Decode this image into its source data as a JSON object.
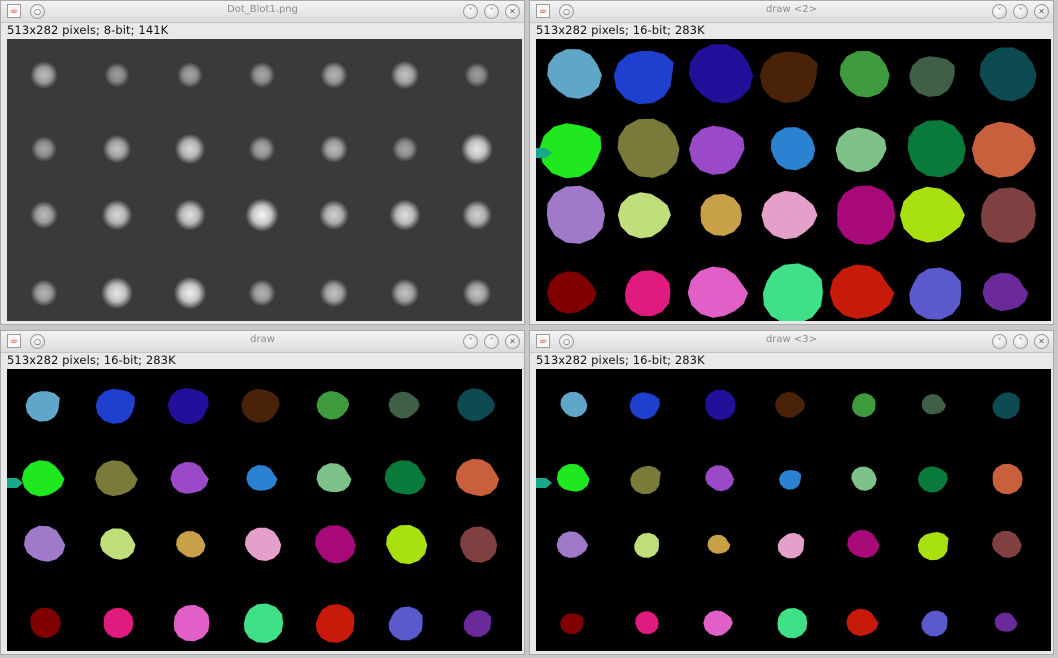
{
  "windows": [
    {
      "key": "w0",
      "title": "Dot_Blot1.png",
      "info": "513x282 pixels; 8-bit; 141K",
      "icon": "java-coffee-icon"
    },
    {
      "key": "w1",
      "title": "draw <2>",
      "info": "513x282 pixels; 16-bit; 283K",
      "icon": "java-coffee-icon"
    },
    {
      "key": "w2",
      "title": "draw",
      "info": "513x282 pixels; 16-bit; 283K",
      "icon": "java-coffee-icon"
    },
    {
      "key": "w3",
      "title": "draw <3>",
      "info": "513x282 pixels; 16-bit; 283K",
      "icon": "java-coffee-icon"
    }
  ],
  "window_buttons": {
    "menu_glyph": "○",
    "minimize_glyph": "˅",
    "maximize_glyph": "˄",
    "close_glyph": "✕"
  },
  "dot_blot": {
    "rows": 4,
    "cols": 7,
    "brightness": [
      [
        0.55,
        0.35,
        0.4,
        0.42,
        0.5,
        0.6,
        0.35
      ],
      [
        0.4,
        0.6,
        0.75,
        0.45,
        0.55,
        0.4,
        0.85
      ],
      [
        0.55,
        0.75,
        0.8,
        0.95,
        0.7,
        0.8,
        0.7
      ],
      [
        0.5,
        0.85,
        0.9,
        0.5,
        0.6,
        0.6,
        0.6
      ]
    ]
  },
  "palette": [
    [
      "#5fa6c8",
      "#1f3fcf",
      "#23109a",
      "#4a2208",
      "#3e9c3e",
      "#3f5f46",
      "#0e4a52"
    ],
    [
      "#1fe81f",
      "#7a7a3a",
      "#9a49c8",
      "#2a82d0",
      "#7ec28a",
      "#0a7a3a",
      "#c8603e"
    ],
    [
      "#a07ac8",
      "#c0de7a",
      "#c8a048",
      "#e4a0c8",
      "#a80a7a",
      "#a8e010",
      "#7e4040"
    ],
    [
      "#800000",
      "#e01a7e",
      "#e060c8",
      "#40e088",
      "#c81a0a",
      "#5a5acc",
      "#6a2a9a"
    ]
  ],
  "arrow_color": "#1aa88a"
}
